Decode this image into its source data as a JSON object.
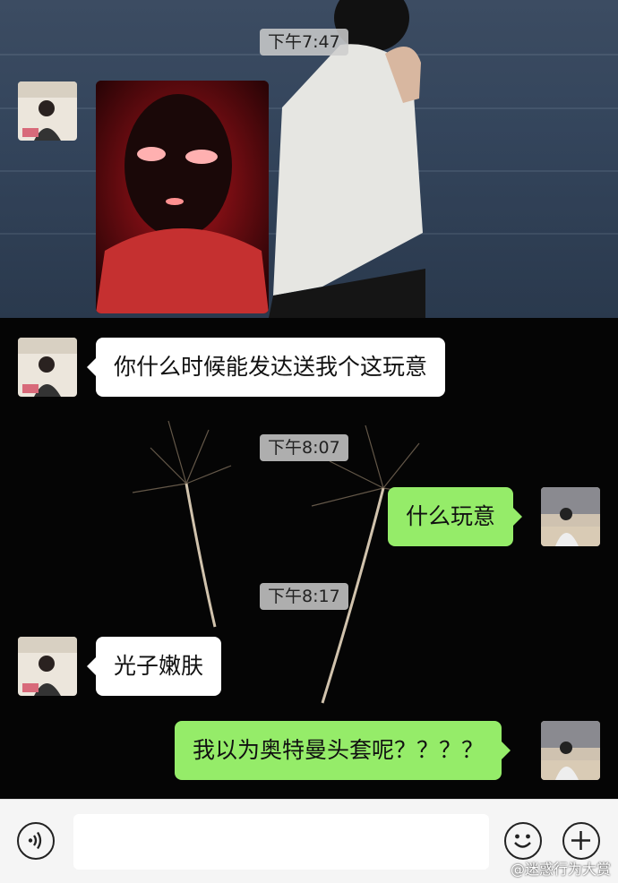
{
  "timestamps": [
    "下午7:47",
    "下午8:07",
    "下午8:17"
  ],
  "messages": {
    "m1_text": "你什么时候能发达送我个这玩意",
    "m2_text": "什么玩意",
    "m3_text": "光子嫩肤",
    "m4_text": "我以为奥特曼头套呢？？？？"
  },
  "toolbar": {
    "voice_icon": "voice-icon",
    "emoji_icon": "emoji-icon",
    "plus_icon": "plus-icon",
    "input_value": ""
  },
  "watermark": "@迷惑行为大赏",
  "colors": {
    "sent_bubble": "#95ec69",
    "received_bubble": "#ffffff",
    "toolbar_bg": "#f5f5f5"
  }
}
